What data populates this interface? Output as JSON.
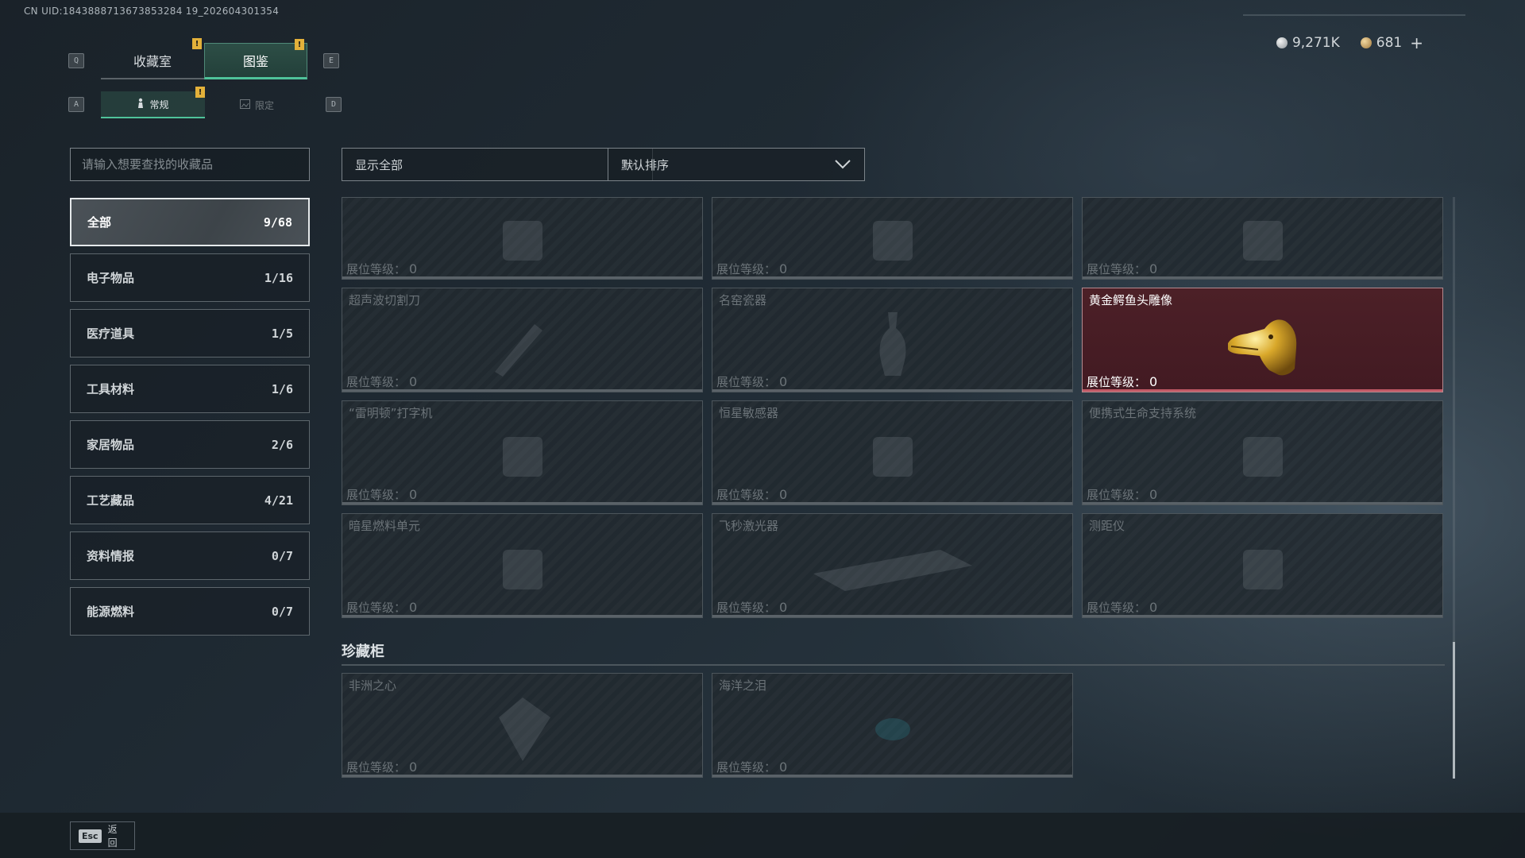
{
  "uid_text": "CN UID:1843888713673853284 19_202604301354",
  "key_hints": {
    "prev_tab": "Q",
    "next_tab": "E",
    "prev_sub": "A",
    "next_sub": "D"
  },
  "main_tabs": [
    {
      "label": "收藏室",
      "badge": "!",
      "active": false
    },
    {
      "label": "图鉴",
      "badge": "!",
      "active": true
    }
  ],
  "sub_tabs": [
    {
      "label": "常规",
      "badge": "!",
      "active": true,
      "icon": "figure-icon"
    },
    {
      "label": "限定",
      "active": false,
      "icon": "frame-icon"
    }
  ],
  "currency": {
    "silver": "9,271K",
    "gold": "681",
    "plus": "+"
  },
  "search": {
    "placeholder": "请输入想要查找的收藏品"
  },
  "filters": {
    "show": "显示全部",
    "sort": "默认排序"
  },
  "categories": [
    {
      "label": "全部",
      "count": "9/68",
      "active": true
    },
    {
      "label": "电子物品",
      "count": "1/16"
    },
    {
      "label": "医疗道具",
      "count": "1/5"
    },
    {
      "label": "工具材料",
      "count": "1/6"
    },
    {
      "label": "家居物品",
      "count": "2/6"
    },
    {
      "label": "工艺藏品",
      "count": "4/21"
    },
    {
      "label": "资料情报",
      "count": "0/7"
    },
    {
      "label": "能源燃料",
      "count": "0/7"
    }
  ],
  "level_label": "展位等级：",
  "items": [
    {
      "name": "",
      "level": "0",
      "icon": "device-icon"
    },
    {
      "name": "",
      "level": "0",
      "icon": "machine-icon"
    },
    {
      "name": "",
      "level": "0",
      "icon": "canister-icon"
    },
    {
      "name": "超声波切割刀",
      "level": "0",
      "icon": "knife-icon"
    },
    {
      "name": "名窑瓷器",
      "level": "0",
      "icon": "vase-icon"
    },
    {
      "name": "黄金鳄鱼头雕像",
      "level": "0",
      "icon": "crocodile-head-icon",
      "owned": true
    },
    {
      "name": "“雷明顿”打字机",
      "level": "0",
      "icon": "typewriter-icon"
    },
    {
      "name": "恒星敏感器",
      "level": "0",
      "icon": "sensor-icon"
    },
    {
      "name": "便携式生命支持系统",
      "level": "0",
      "icon": "life-support-icon"
    },
    {
      "name": "暗星燃料单元",
      "level": "0",
      "icon": "fuel-cell-icon"
    },
    {
      "name": "飞秒激光器",
      "level": "0",
      "icon": "laser-icon"
    },
    {
      "name": "测距仪",
      "level": "0",
      "icon": "rangefinder-icon"
    }
  ],
  "vault": {
    "title": "珍藏柜",
    "items": [
      {
        "name": "非洲之心",
        "level": "0",
        "icon": "diamond-icon"
      },
      {
        "name": "海洋之泪",
        "level": "0",
        "icon": "gem-icon"
      }
    ]
  },
  "esc": {
    "key": "Esc",
    "label": "返回"
  },
  "colors": {
    "accent": "#4fc39a",
    "badge": "#e3b13a",
    "owned_bg": "#4c2027"
  }
}
